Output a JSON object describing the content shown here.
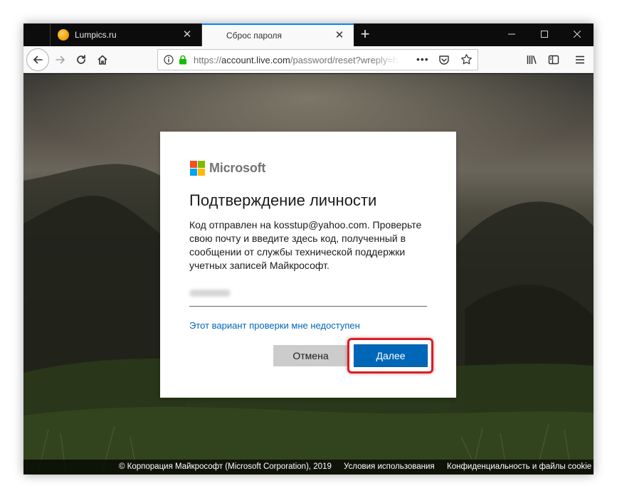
{
  "browser": {
    "tabs": [
      {
        "title": "Lumpics.ru",
        "favicon": "lumpics-favicon",
        "active": false
      },
      {
        "title": "Сброс пароля",
        "favicon": "microsoft-favicon",
        "active": true
      }
    ],
    "new_tab_glyph": "+",
    "close_glyph": "✕",
    "address": {
      "scheme": "https://",
      "host": "account.live.com",
      "path": "/password/reset?wreply=h"
    },
    "more_glyph": "•••"
  },
  "dialog": {
    "brand": "Microsoft",
    "title": "Подтверждение личности",
    "description": "Код отправлен на kosstup@yahoo.com. Проверьте свою почту и введите здесь код, полученный в сообщении от службы технической поддержки учетных записей Майкрософт.",
    "code_value": "",
    "unavailable_link": "Этот вариант проверки мне недоступен",
    "cancel_label": "Отмена",
    "next_label": "Далее"
  },
  "footer": {
    "copyright": "© Корпорация Майкрософт (Microsoft Corporation), 2019",
    "terms": "Условия использования",
    "privacy": "Конфиденциальность и файлы cookie"
  },
  "colors": {
    "accent": "#0067b8",
    "highlight": "#d71f26",
    "tab_active_border": "#0a84ff"
  }
}
